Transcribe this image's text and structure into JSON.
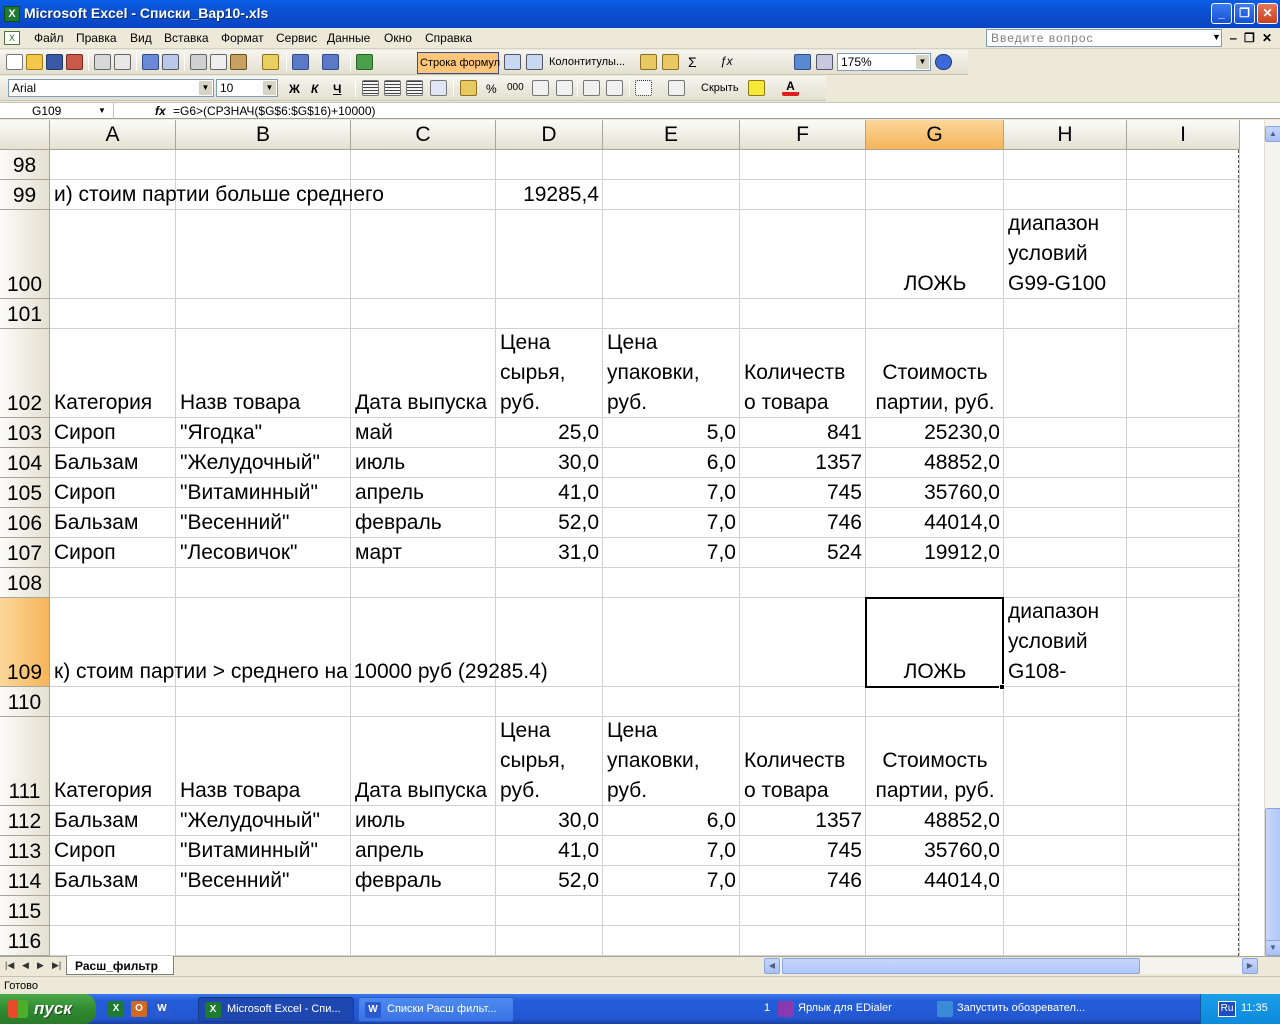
{
  "window": {
    "title": "Microsoft Excel - Списки_Вар10-.xls",
    "min_label": "_",
    "max_label": "❐",
    "close_label": "✕"
  },
  "menu": {
    "items": [
      "Файл",
      "Правка",
      "Вид",
      "Вставка",
      "Формат",
      "Сервис",
      "Данные",
      "Окно",
      "Справка"
    ],
    "ask_placeholder": "Введите вопрос",
    "doc_min": "‒",
    "doc_restore": "❐",
    "doc_close": "✕"
  },
  "toolbar": {
    "formula_bar_button": "Строка формул",
    "headers_footers_button": "Колонтитулы...",
    "zoom": "175%",
    "font_name": "Arial",
    "font_size": "10",
    "bold_label": "Ж",
    "italic_label": "К",
    "underline_label": "Ч",
    "percent_label": "%",
    "thousands_label": "000",
    "hide_label": "Скрыть"
  },
  "formula_bar": {
    "name_box": "G109",
    "fx_label": "fx",
    "formula": "=G6>(СРЗНАЧ($G$6:$G$16)+10000)"
  },
  "columns": [
    "A",
    "B",
    "C",
    "D",
    "E",
    "F",
    "G",
    "H",
    "I"
  ],
  "rows": [
    "98",
    "99",
    "100",
    "101",
    "102",
    "103",
    "104",
    "105",
    "106",
    "107",
    "108",
    "109",
    "110",
    "111",
    "112",
    "113",
    "114",
    "115",
    "116"
  ],
  "cells": {
    "a99": "и) стоим  партии больше среднего",
    "d99": "19285,4",
    "g100": "ЛОЖЬ",
    "h100": "диапазон условий G99-G100",
    "hdr1": {
      "a": "Категория",
      "b": "Назв товара",
      "c": "Дата выпуска",
      "d": "Цена сырья, руб.",
      "e": "Цена упаковки, руб.",
      "f": "Количеств о товара",
      "g": "Стоимость партии, руб."
    },
    "table1": [
      [
        "Сироп",
        "\"Ягодка\"",
        "май",
        "25,0",
        "5,0",
        "841",
        "25230,0"
      ],
      [
        "Бальзам",
        "\"Желудочный\"",
        "июль",
        "30,0",
        "6,0",
        "1357",
        "48852,0"
      ],
      [
        "Сироп",
        "\"Витаминный\"",
        "апрель",
        "41,0",
        "7,0",
        "745",
        "35760,0"
      ],
      [
        "Бальзам",
        "\"Весенний\"",
        "февраль",
        "52,0",
        "7,0",
        "746",
        "44014,0"
      ],
      [
        "Сироп",
        "\"Лесовичок\"",
        "март",
        "31,0",
        "7,0",
        "524",
        "19912,0"
      ]
    ],
    "a109": "к) стоим партии > среднего на 10000 руб (29285.4)",
    "g109": "ЛОЖЬ",
    "h109": "диапазон условий G108-",
    "hdr2": {
      "a": "Категория",
      "b": "Назв товара",
      "c": "Дата выпуска",
      "d": "Цена сырья, руб.",
      "e": "Цена упаковки, руб.",
      "f": "Количеств о товара",
      "g": "Стоимость партии, руб."
    },
    "table2": [
      [
        "Бальзам",
        "\"Желудочный\"",
        "июль",
        "30,0",
        "6,0",
        "1357",
        "48852,0"
      ],
      [
        "Сироп",
        "\"Витаминный\"",
        "апрель",
        "41,0",
        "7,0",
        "745",
        "35760,0"
      ],
      [
        "Бальзам",
        "\"Весенний\"",
        "февраль",
        "52,0",
        "7,0",
        "746",
        "44014,0"
      ]
    ]
  },
  "sheet_tab": "Расш_фильтр",
  "status": "Готово",
  "taskbar": {
    "start": "пуск",
    "tasks": [
      "Microsoft Excel - Спи...",
      "Списки Расш фильт..."
    ],
    "tray_count": "1",
    "tray_items": [
      "Ярлык для EDialer",
      "Запустить обозревател..."
    ],
    "lang": "Ru",
    "clock": "11:35"
  }
}
